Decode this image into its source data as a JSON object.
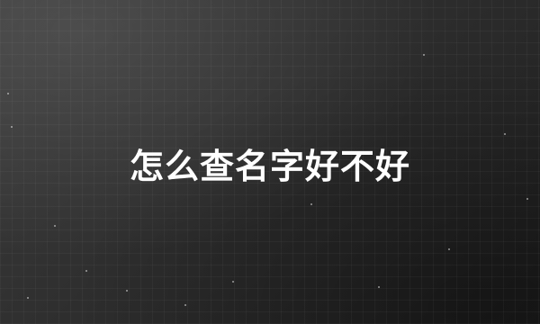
{
  "title": "怎么查名字好不好"
}
